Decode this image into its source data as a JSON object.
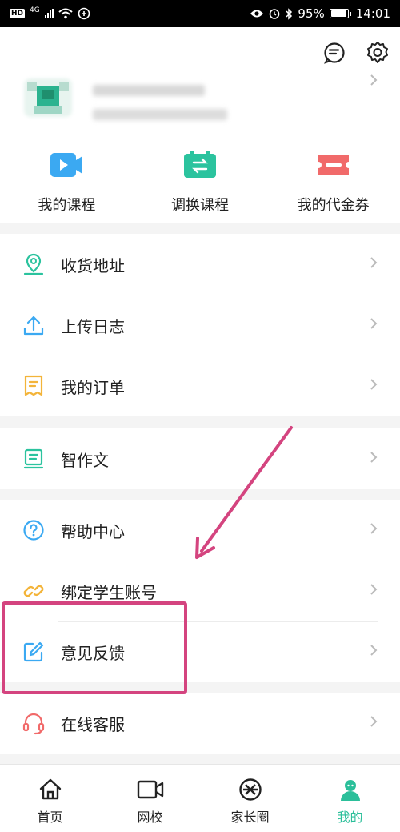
{
  "status_bar": {
    "hd": "HD",
    "network": "4G",
    "battery": "95%",
    "battery_level": 0.95,
    "time": "14:01"
  },
  "header": {
    "icons": [
      "message-icon",
      "settings-icon"
    ]
  },
  "quick_actions": [
    {
      "label": "我的课程",
      "icon": "video-icon",
      "color": "#3ba9f2"
    },
    {
      "label": "调换课程",
      "icon": "swap-icon",
      "color": "#2bc39e"
    },
    {
      "label": "我的代金券",
      "icon": "coupon-icon",
      "color": "#f16a6a"
    }
  ],
  "menu_groups": [
    [
      {
        "label": "收货地址",
        "icon": "location-icon",
        "color": "#2bc39e"
      },
      {
        "label": "上传日志",
        "icon": "upload-icon",
        "color": "#3ba9f2"
      },
      {
        "label": "我的订单",
        "icon": "order-icon",
        "color": "#f3b43a"
      }
    ],
    [
      {
        "label": "智作文",
        "icon": "essay-icon",
        "color": "#2bc39e"
      }
    ],
    [
      {
        "label": "帮助中心",
        "icon": "help-icon",
        "color": "#3ba9f2"
      },
      {
        "label": "绑定学生账号",
        "icon": "link-icon",
        "color": "#f3b43a"
      },
      {
        "label": "意见反馈",
        "icon": "edit-icon",
        "color": "#3ba9f2"
      }
    ],
    [
      {
        "label": "在线客服",
        "icon": "headset-icon",
        "color": "#f16a6a"
      }
    ]
  ],
  "bottom_nav": [
    {
      "label": "首页",
      "icon": "home-icon"
    },
    {
      "label": "网校",
      "icon": "camera-icon"
    },
    {
      "label": "家长圈",
      "icon": "circle-icon"
    },
    {
      "label": "我的",
      "icon": "profile-icon",
      "active": true
    }
  ],
  "colors": {
    "accent": "#2bbf9a",
    "annotation": "#d4447f"
  }
}
